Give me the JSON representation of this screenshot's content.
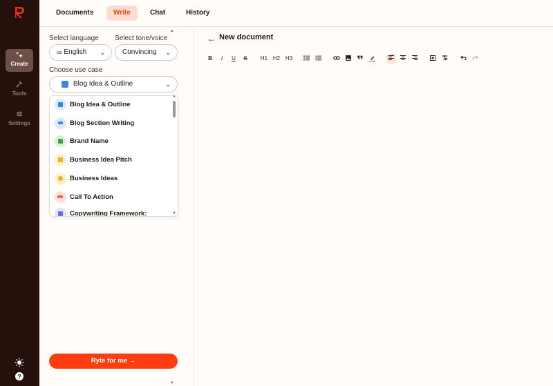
{
  "app": {
    "logo_letter": "R",
    "brand_color": "#e8321a"
  },
  "rail": {
    "items": [
      {
        "label": "Create",
        "icon": "sparkles-icon"
      },
      {
        "label": "Tools",
        "icon": "wrench-icon"
      },
      {
        "label": "Settings",
        "icon": "sliders-icon"
      }
    ],
    "bottom": [
      {
        "icon": "sun-icon"
      },
      {
        "icon": "help-icon"
      }
    ]
  },
  "tabs": [
    "Documents",
    "Write",
    "Chat",
    "History"
  ],
  "form": {
    "language_label": "Select language",
    "language_flag": "us",
    "language_value": "English",
    "tone_label": "Select tone/voice",
    "tone_value": "Convincing",
    "usecase_label": "Choose use case",
    "usecase_value": "Blog Idea & Outline",
    "options": [
      {
        "label": "Blog Idea & Outline",
        "color": "#dbe9fb",
        "icon_color": "#3a86e0"
      },
      {
        "label": "Blog Section Writing",
        "color": "#dbe9fb",
        "icon_color": "#3a86e0"
      },
      {
        "label": "Brand Name",
        "color": "#d8efd9",
        "icon_color": "#4b9b55"
      },
      {
        "label": "Business Idea Pitch",
        "color": "#fdf0c8",
        "icon_color": "#e7b52b"
      },
      {
        "label": "Business Ideas",
        "color": "#fdf0c8",
        "icon_color": "#e7b52b"
      },
      {
        "label": "Call To Action",
        "color": "#fde0da",
        "icon_color": "#e06a52"
      },
      {
        "label": "Copywriting Framework:",
        "color": "#e3e3fb",
        "icon_color": "#6c6ce0"
      }
    ],
    "submit_label": "Ryte for me →"
  },
  "editor": {
    "title": "New document",
    "toolbar": [
      "B",
      "I",
      "U",
      "S",
      "H1",
      "H2",
      "H3"
    ]
  }
}
